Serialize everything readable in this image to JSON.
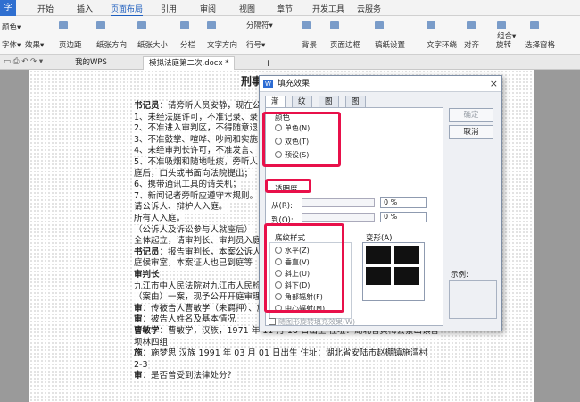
{
  "menubar": {
    "app_label": "字",
    "items": [
      "开始",
      "插入",
      "页面布局",
      "引用",
      "审阅",
      "视图",
      "章节",
      "开发工具",
      "云服务"
    ],
    "active": "页面布局"
  },
  "ribbon": {
    "row1": [
      "颜色▾",
      "页边距",
      "纸张方向",
      "纸张大小",
      "分栏",
      "文字方向",
      "分隔符▾",
      "背景",
      "页面边框",
      "稿纸设置",
      "文字环绕",
      "对齐",
      "旋转",
      "选择窗格"
    ],
    "row2": [
      "字体▾",
      "效果▾",
      "行号▾",
      "组合▾"
    ]
  },
  "tabs": {
    "home": "我的WPS",
    "doc": "模拟法庭第二次.docx *",
    "add": "+"
  },
  "document": {
    "title": "刑事附带",
    "lines": [
      {
        "bold": "书记员",
        "text": "：请旁听人员安静，现在公"
      },
      {
        "bold": "",
        "text": "1、未经法庭许可，不准记录、录"
      },
      {
        "bold": "",
        "text": "2、不准进入审判区，不得随意退"
      },
      {
        "bold": "",
        "text": "3、不准鼓掌、喧哗、吵闹和实施"
      },
      {
        "bold": "",
        "text": "4、未经审判长许可，不准发言、"
      },
      {
        "bold": "",
        "text": "5、不准吸烟和随地吐痰，旁听人"
      },
      {
        "bold": "",
        "text": "庭后，口头或书面向法院提出；"
      },
      {
        "bold": "",
        "text": "6、携带通讯工具的请关机；"
      },
      {
        "bold": "",
        "text": "7、新闻记者旁听应遵守本规则。"
      },
      {
        "bold": "",
        "text": "请公诉人、辩护人入庭。"
      },
      {
        "bold": "",
        "text": "所有人入庭。"
      },
      {
        "bold": "",
        "text": "（公诉人及诉讼参与人就座后）"
      },
      {
        "bold": "",
        "text": "全体起立，请审判长、审判员入庭"
      },
      {
        "bold": "书记员",
        "text": "：报告审判长，本案公诉人"
      },
      {
        "bold": "",
        "text": "庭候审室，本案证人也已到庭等"
      },
      {
        "bold": "审判长",
        "text": ""
      },
      {
        "bold": "",
        "text": "九江市中人民法院对九江市人民检"
      },
      {
        "bold": "",
        "text": "（案由）一案，现予公开开庭审理"
      },
      {
        "bold": "审",
        "text": "：传被告人曹敏学（未羁押）、施"
      },
      {
        "bold": "审",
        "text": "：被告人姓名及基本情况"
      },
      {
        "bold": "曹敏学",
        "text": "：曹敏学，汉族，1971 年 11 月 18 日出生 住址：湖北省黄梅县蔡山镇曹"
      },
      {
        "bold": "",
        "text": "坝林四组"
      },
      {
        "bold": "施",
        "text": "：施梦思 汉族 1991 年 03 月 01 日出生 住址：湖北省安陆市赵棚镇施湾村"
      },
      {
        "bold": "",
        "text": "2-3"
      },
      {
        "bold": "审",
        "text": "：是否曾受到法律处分？"
      }
    ]
  },
  "dialog": {
    "title": "填充效果",
    "logo": "W",
    "close": "×",
    "tabs": [
      "渐变",
      "纹理",
      "图案",
      "图片"
    ],
    "active_tab": "渐变",
    "colors_label": "颜色",
    "color_options": [
      "单色(N)",
      "双色(T)",
      "预设(S)"
    ],
    "transparency_label": "透明度",
    "from_label": "从(R):",
    "to_label": "到(O):",
    "from_value": "0 %",
    "to_value": "0 %",
    "shading_label": "底纹样式",
    "shading_options": [
      "水平(Z)",
      "垂直(V)",
      "斜上(U)",
      "斜下(D)",
      "角部辐射(F)",
      "中心辐射(M)"
    ],
    "variants_label": "变形(A)",
    "sample_label": "示例:",
    "rotate_label": "随图形旋转填充效果(W)",
    "ok": "确定",
    "cancel": "取消"
  }
}
